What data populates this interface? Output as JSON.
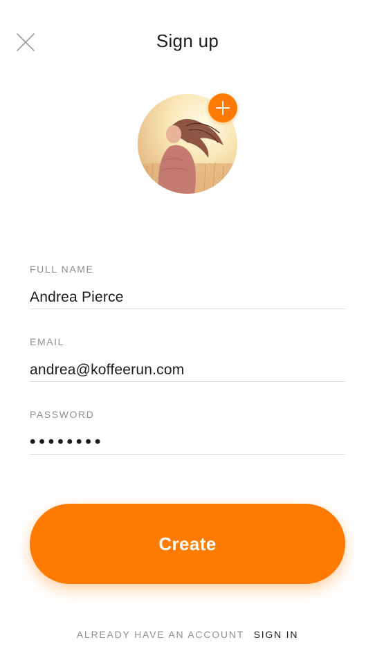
{
  "header": {
    "title": "Sign up",
    "close_icon": "close-icon"
  },
  "avatar": {
    "add_icon": "plus-icon",
    "accent": "#ff7a00"
  },
  "form": {
    "full_name": {
      "label": "FULL NAME",
      "value": "Andrea Pierce"
    },
    "email": {
      "label": "EMAIL",
      "value": "andrea@koffeerun.com"
    },
    "password": {
      "label": "PASSWORD",
      "value": "••••••••"
    }
  },
  "actions": {
    "create_label": "Create"
  },
  "footer": {
    "prompt": "ALREADY HAVE AN ACCOUNT",
    "sign_in_label": "SIGN IN"
  },
  "colors": {
    "accent": "#ff7a00",
    "label": "#8e8e93",
    "text": "#1c1c1e",
    "divider": "#dcdcdc"
  }
}
